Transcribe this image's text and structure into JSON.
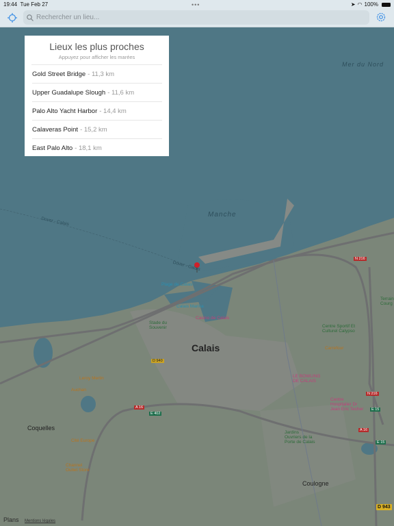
{
  "status": {
    "time": "19:44",
    "date": "Tue Feb 27",
    "battery": "100%"
  },
  "search": {
    "placeholder": "Rechercher un lieu..."
  },
  "icons": {
    "locate": "crosshair-icon",
    "search": "magnifier-icon",
    "settings": "gear-icon",
    "pin": "map-pin-icon"
  },
  "colors": {
    "accent": "#3a8ee6",
    "sea": "#4f7785",
    "land": "#7b8679",
    "pin": "#d0202a"
  },
  "panel": {
    "title": "Lieux les plus proches",
    "subtitle": "Appuyez pour afficher les marées",
    "items": [
      {
        "name": "Gold Street Bridge",
        "distance": "- 11,3 km"
      },
      {
        "name": "Upper Guadalupe Slough",
        "distance": "- 11,6 km"
      },
      {
        "name": "Palo Alto Yacht Harbor",
        "distance": "- 14,4 km"
      },
      {
        "name": "Calaveras Point",
        "distance": "- 15,2 km"
      },
      {
        "name": "East Palo Alto",
        "distance": "- 18,1 km"
      }
    ]
  },
  "map": {
    "labels": {
      "mer_du_nord": "Mer du Nord",
      "manche": "Manche",
      "dover_calais": "Dover - Calais",
      "dover_calais2": "Dover - Calais",
      "calais": "Calais",
      "coquelles": "Coquelles",
      "coulogne": "Coulogne",
      "plage": "Plage de Calais",
      "marina": "Calais Marina",
      "casino": "Casino de Calais",
      "stade": "Stade du Souvenir",
      "centre_sportif": "Centre Sportif Et Culturel Calypso",
      "carrefour": "Carrefour",
      "bowling": "LE BOWLING DE CALAIS",
      "hopital": "Centre Hospitalier Dr Jean Eric Techer",
      "terrain": "Terrain Courg",
      "jardins": "Jardins Ouvriers de la Porte de Calais",
      "leroy": "Leroy Merlin",
      "auchan": "Auchan",
      "cite_europe": "Cité Europe",
      "channel": "Channel Outlet Store",
      "n216": "N 216",
      "n216b": "N 216",
      "e15": "E 15",
      "e15b": "E 15",
      "a16": "A 16",
      "a16b": "A 16",
      "e402": "E 402",
      "d940": "D 940",
      "d943": "D 943"
    }
  },
  "footer": {
    "brand": "Plans",
    "legal": "Mentions légales"
  }
}
